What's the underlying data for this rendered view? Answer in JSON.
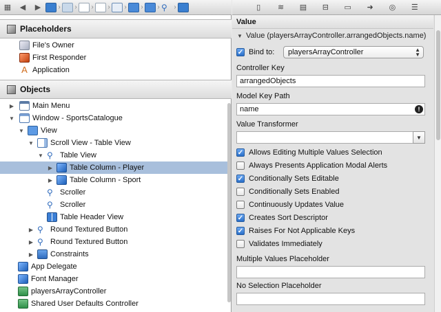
{
  "jumpbar": {
    "items": [
      "grid-icon",
      "back-icon",
      "forward-icon",
      "file-icon",
      "folder-icon",
      "group-icon",
      "group-icon",
      "window-icon",
      "view-icon",
      "scroll-view-icon",
      "table-view-icon",
      "table-column-icon"
    ]
  },
  "placeholders": {
    "title": "Placeholders",
    "items": [
      {
        "label": "File's Owner",
        "icon": "files-owner-icon"
      },
      {
        "label": "First Responder",
        "icon": "first-responder-icon"
      },
      {
        "label": "Application",
        "icon": "application-icon"
      }
    ]
  },
  "objects": {
    "title": "Objects",
    "items": [
      {
        "label": "Main Menu",
        "icon": "menu-icon",
        "expanded": false,
        "selected": false
      },
      {
        "label": "Window - SportsCatalogue",
        "icon": "window-icon",
        "expanded": true,
        "selected": false
      },
      {
        "label": "View",
        "icon": "view-icon",
        "expanded": true,
        "selected": false
      },
      {
        "label": "Scroll View - Table View",
        "icon": "scroll-view-icon",
        "expanded": true,
        "selected": false
      },
      {
        "label": "Table View",
        "icon": "table-view-icon",
        "expanded": true,
        "selected": false
      },
      {
        "label": "Table Column - Player",
        "icon": "table-column-icon",
        "expanded": false,
        "selected": true
      },
      {
        "label": "Table Column - Sport",
        "icon": "table-column-icon",
        "expanded": false,
        "selected": false
      },
      {
        "label": "Scroller",
        "icon": "scroller-icon",
        "selected": false
      },
      {
        "label": "Scroller",
        "icon": "scroller-icon",
        "selected": false
      },
      {
        "label": "Table Header View",
        "icon": "table-header-icon",
        "selected": false
      },
      {
        "label": "Round Textured Button",
        "icon": "button-icon",
        "expanded": false,
        "selected": false
      },
      {
        "label": "Round Textured Button",
        "icon": "button-icon",
        "expanded": false,
        "selected": false
      },
      {
        "label": "Constraints",
        "icon": "constraints-icon",
        "expanded": false,
        "selected": false
      },
      {
        "label": "App Delegate",
        "icon": "object-icon",
        "selected": false
      },
      {
        "label": "Font Manager",
        "icon": "object-icon",
        "selected": false
      },
      {
        "label": "playersArrayController",
        "icon": "array-controller-icon",
        "selected": false
      },
      {
        "label": "Shared User Defaults Controller",
        "icon": "defaults-controller-icon",
        "selected": false
      }
    ]
  },
  "inspector": {
    "tabs": [
      "file-icon",
      "quick-help-icon",
      "identity-icon",
      "attributes-icon",
      "size-icon",
      "connections-icon",
      "bindings-icon",
      "effects-icon"
    ],
    "section_title": "Value",
    "subsection": "Value (playersArrayController.arrangedObjects.name)",
    "bind_to_label": "Bind to:",
    "bind_to_checked": true,
    "bind_to_value": "playersArrayController",
    "controller_key_label": "Controller Key",
    "controller_key_value": "arrangedObjects",
    "model_key_path_label": "Model Key Path",
    "model_key_path_value": "name",
    "value_transformer_label": "Value Transformer",
    "value_transformer_value": "",
    "options": [
      {
        "label": "Allows Editing Multiple Values Selection",
        "checked": true
      },
      {
        "label": "Always Presents Application Modal Alerts",
        "checked": false
      },
      {
        "label": "Conditionally Sets Editable",
        "checked": true
      },
      {
        "label": "Conditionally Sets Enabled",
        "checked": false
      },
      {
        "label": "Continuously Updates Value",
        "checked": false
      },
      {
        "label": "Creates Sort Descriptor",
        "checked": true
      },
      {
        "label": "Raises For Not Applicable Keys",
        "checked": true
      },
      {
        "label": "Validates Immediately",
        "checked": false
      }
    ],
    "multiple_values_placeholder_label": "Multiple Values Placeholder",
    "multiple_values_placeholder_value": "",
    "no_selection_placeholder_label": "No Selection Placeholder",
    "no_selection_placeholder_value": ""
  }
}
